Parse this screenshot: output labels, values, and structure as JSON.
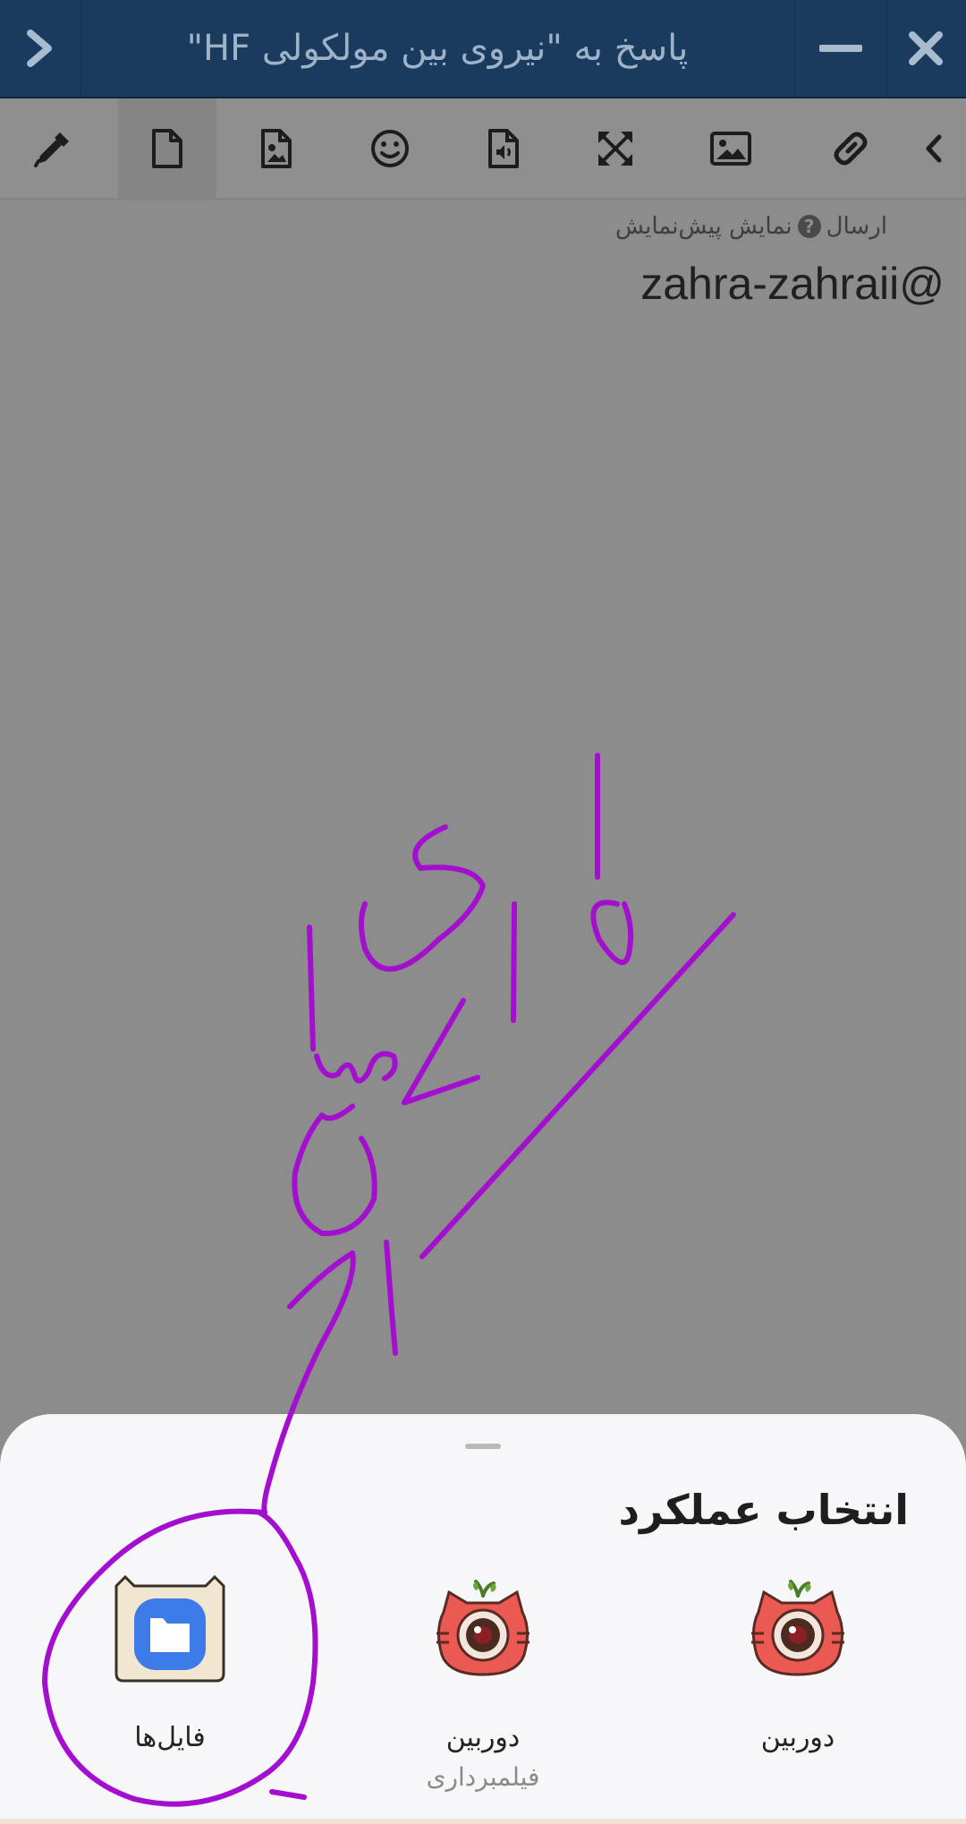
{
  "header": {
    "title": "پاسخ به \"نیروی بین مولکولی HF\"",
    "back_icon": "chevron-right-icon",
    "minimize_icon": "minus-icon",
    "close_icon": "close-icon",
    "background": "#1b3b5e"
  },
  "toolbar": {
    "tools": [
      "eyedropper-icon",
      "file-icon",
      "image-file-icon",
      "emoji-icon",
      "audio-file-icon",
      "fullscreen-icon",
      "image-icon",
      "link-icon",
      "chevron-left-icon"
    ],
    "active_tool": "file-icon"
  },
  "editor": {
    "meta_send": "ارسال",
    "meta_preview": "نمایش پیش‌نمایش",
    "help_icon": "question-icon",
    "text": "zahra-zahraii@"
  },
  "sheet": {
    "title": "انتخاب عملکرد",
    "apps": [
      {
        "label": "دوربین",
        "sublabel": "",
        "icon": "camera-app-icon"
      },
      {
        "label": "دوربین",
        "sublabel": "فیلمبرداری",
        "icon": "camera-app-icon"
      },
      {
        "label": "فایل‌ها",
        "sublabel": "",
        "icon": "files-app-icon"
      }
    ]
  },
  "annotation": {
    "color": "#a40fcf",
    "note": "handwritten purple strokes circling the Files app"
  }
}
